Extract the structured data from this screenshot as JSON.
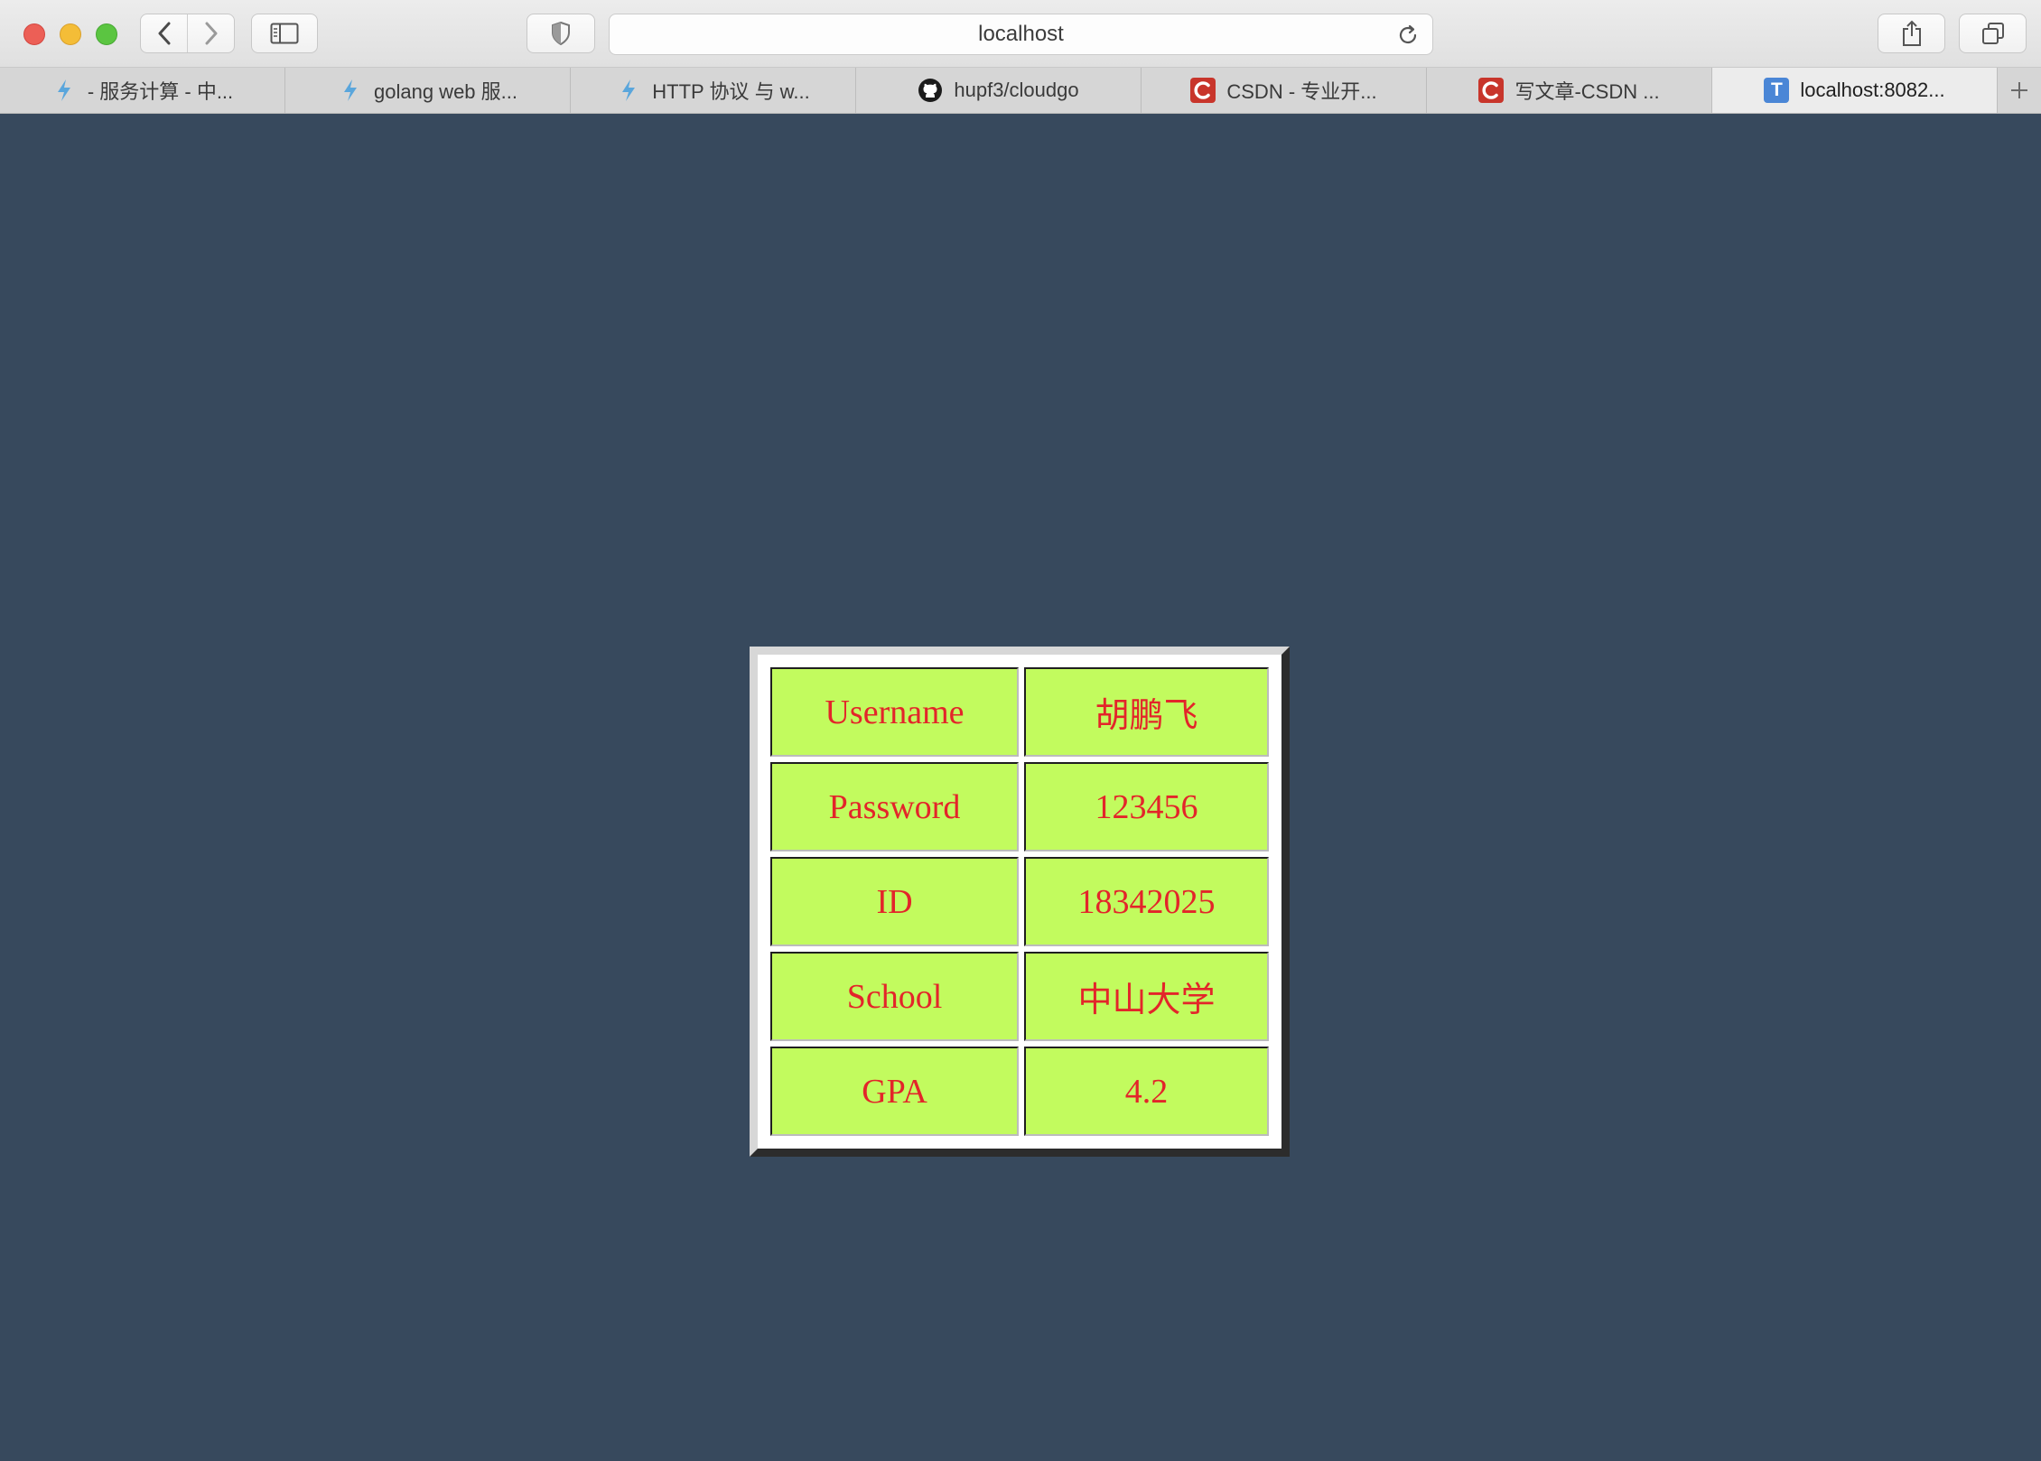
{
  "browser": {
    "address": "localhost",
    "tabs": [
      {
        "label": "- 服务计算 - 中...",
        "icon": "bolt-icon"
      },
      {
        "label": "golang web 服...",
        "icon": "bolt-icon"
      },
      {
        "label": "HTTP 协议 与 w...",
        "icon": "bolt-icon"
      },
      {
        "label": "hupf3/cloudgo",
        "icon": "github-icon"
      },
      {
        "label": "CSDN - 专业开...",
        "icon": "csdn-icon"
      },
      {
        "label": "写文章-CSDN ...",
        "icon": "csdn-icon"
      },
      {
        "label": "localhost:8082...",
        "icon": "t-icon",
        "active": true
      }
    ]
  },
  "profile": {
    "rows": [
      {
        "key": "Username",
        "value": "胡鹏飞"
      },
      {
        "key": "Password",
        "value": "123456"
      },
      {
        "key": "ID",
        "value": "18342025"
      },
      {
        "key": "School",
        "value": "中山大学"
      },
      {
        "key": "GPA",
        "value": "4.2"
      }
    ]
  },
  "colors": {
    "page_background": "#37495d",
    "cell_background": "#c2fb5e",
    "cell_text": "#e3252a"
  }
}
